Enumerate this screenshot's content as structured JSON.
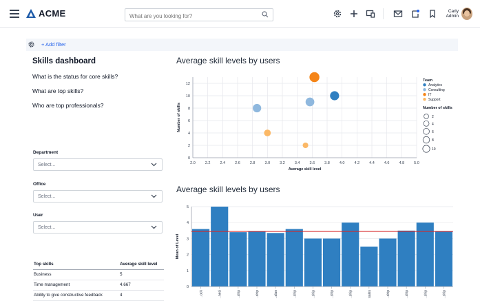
{
  "app": {
    "brand": "ACME"
  },
  "search": {
    "placeholder": "What are you looking for?"
  },
  "user": {
    "first": "Carly",
    "last": "Admin"
  },
  "filters": {
    "add_label": "+ Add filter"
  },
  "sidebar": {
    "title": "Skills dashboard",
    "questions": [
      "What is the status for core skills?",
      "What are top skills?",
      "Who are top professionals?"
    ],
    "dropdowns": [
      {
        "label": "Department",
        "value": "Select..."
      },
      {
        "label": "Office",
        "value": "Select..."
      },
      {
        "label": "User",
        "value": "Select..."
      }
    ]
  },
  "table": {
    "headers": [
      "Top skills",
      "Average skill level"
    ],
    "rows": [
      [
        "Business",
        "5"
      ],
      [
        "Time management",
        "4.667"
      ],
      [
        "Ability to give constructive feedback",
        "4"
      ]
    ]
  },
  "colors": {
    "analytics": "#2f7fc1",
    "consulting": "#8fb8de",
    "it": "#f58518",
    "support": "#fbb866",
    "bar": "#2f7fc1",
    "avgline": "#d62728"
  },
  "chart_data": [
    {
      "type": "scatter",
      "title": "Average skill levels by users",
      "xlabel": "Average skill level",
      "ylabel": "Number of skills",
      "xlim": [
        2.0,
        5.0
      ],
      "ylim": [
        0,
        13
      ],
      "xticks": [
        "2.0",
        "2.2",
        "2.4",
        "2.6",
        "2.8",
        "3.0",
        "3.2",
        "3.4",
        "3.6",
        "3.8",
        "4.0",
        "4.2",
        "4.4",
        "4.6",
        "4.8",
        "5.0"
      ],
      "yticks": [
        "0",
        "2",
        "4",
        "6",
        "8",
        "10",
        "12"
      ],
      "legend": {
        "team_title": "Team",
        "teams": [
          {
            "name": "Analytics",
            "color": "#2f7fc1"
          },
          {
            "name": "Consulting",
            "color": "#8fb8de"
          },
          {
            "name": "IT",
            "color": "#f58518"
          },
          {
            "name": "Support",
            "color": "#fbb866"
          }
        ],
        "size_title": "Number of skills",
        "sizes": [
          "2",
          "4",
          "6",
          "8",
          "10"
        ]
      },
      "points": [
        {
          "x": 2.86,
          "y": 8,
          "team": "Consulting"
        },
        {
          "x": 3.0,
          "y": 4,
          "team": "Support"
        },
        {
          "x": 3.51,
          "y": 2,
          "team": "Support"
        },
        {
          "x": 3.57,
          "y": 9,
          "team": "Consulting"
        },
        {
          "x": 3.63,
          "y": 13,
          "team": "IT"
        },
        {
          "x": 3.9,
          "y": 10,
          "team": "Analytics"
        }
      ]
    },
    {
      "type": "bar",
      "title": "Average skill levels by users",
      "ylabel": "Mean of Level",
      "ylim": [
        0,
        5
      ],
      "yticks": [
        "0",
        "1",
        "2",
        "3",
        "4",
        "5"
      ],
      "average": 3.45,
      "categories": [
        "..ock",
        "..nesi",
        "..ship",
        "..ship",
        "..alan",
        "..ship",
        "..ship",
        "..ship",
        "..ship",
        "..sales",
        "..ship",
        "..ship",
        "..ship",
        "..ship"
      ],
      "values": [
        3.6,
        5.0,
        3.4,
        3.45,
        3.35,
        3.6,
        3.0,
        3.0,
        4.0,
        2.5,
        3.0,
        3.5,
        4.0,
        3.45
      ]
    }
  ]
}
